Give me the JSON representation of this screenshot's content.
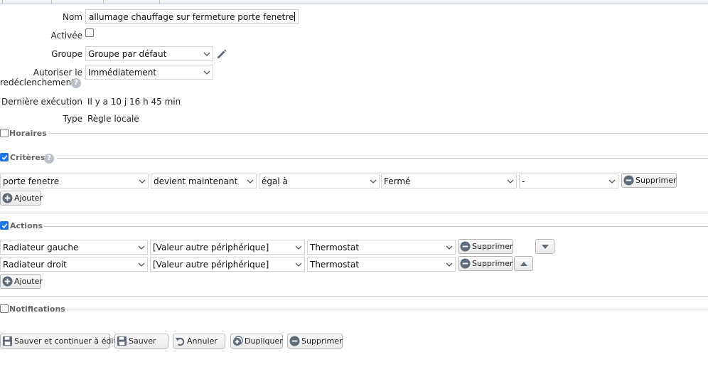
{
  "form": {
    "nom_label": "Nom",
    "nom_value": "allumage chauffage sur fermeture porte fenetre",
    "activee_label": "Activée",
    "groupe_label": "Groupe",
    "groupe_value": "Groupe par défaut",
    "autoriser_label_1": "Autoriser le",
    "autoriser_label_2": "redéclenchement",
    "autoriser_value": "Immédiatement",
    "derniere_label": "Dernière exécution",
    "derniere_value": "Il y a 10 j 16 h 45 min",
    "type_label": "Type",
    "type_value": "Règle locale"
  },
  "sections": {
    "horaires": "Horaires",
    "criteres": "Critères",
    "actions": "Actions",
    "notifications": "Notifications"
  },
  "criteres": {
    "row": [
      "porte fenetre",
      "devient maintenant",
      "égal à",
      "Fermé",
      "-"
    ],
    "delete_label": "Supprimer",
    "add_label": "Ajouter"
  },
  "actions": {
    "rows": [
      [
        "Radiateur gauche",
        "[Valeur autre périphérique]",
        "Thermostat"
      ],
      [
        "Radiateur droit",
        "[Valeur autre périphérique]",
        "Thermostat"
      ]
    ],
    "delete_label": "Supprimer",
    "add_label": "Ajouter"
  },
  "footer": {
    "save_continue": "Sauver et continuer à éditer",
    "save": "Sauver",
    "cancel": "Annuler",
    "duplicate": "Dupliquer",
    "delete": "Supprimer"
  },
  "colors": {
    "accent": "#1a73e8",
    "icon_grey": "#5f6b7a"
  }
}
